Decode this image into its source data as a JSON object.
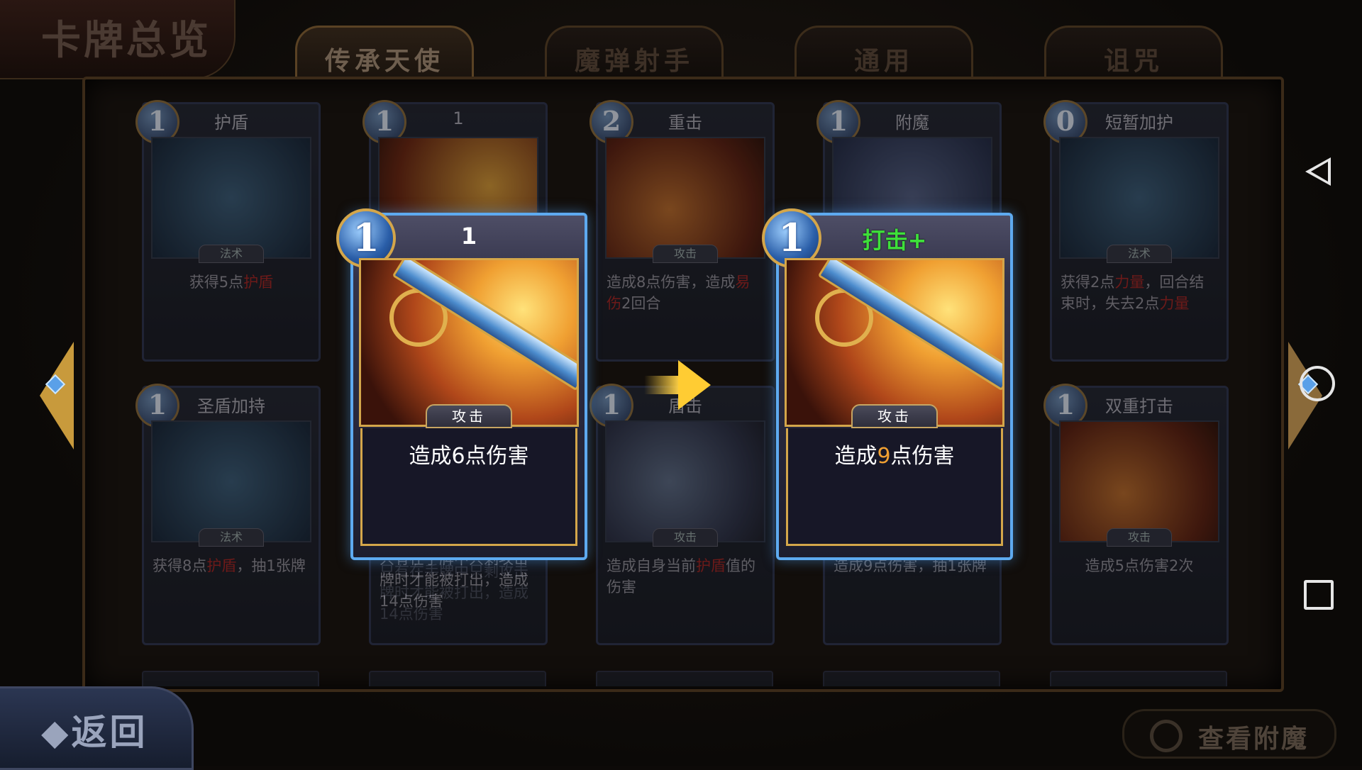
{
  "header": {
    "title": "卡牌总览"
  },
  "tabs": [
    {
      "label": "传承天使",
      "active": true
    },
    {
      "label": "魔弹射手",
      "active": false
    },
    {
      "label": "通用",
      "active": false
    },
    {
      "label": "诅咒",
      "active": false
    }
  ],
  "cards": [
    {
      "cost": "1",
      "name": "护盾",
      "type": "法术",
      "desc_parts": [
        "获得5点",
        "护盾"
      ]
    },
    {
      "cost": "1",
      "name": "1",
      "type": "",
      "desc": "只有在手牌中只剩攻击牌时才能被打出，造成14点伤害"
    },
    {
      "cost": "2",
      "name": "重击",
      "type": "攻击",
      "desc_parts": [
        "造成8点伤害，造成",
        "易伤",
        "2回合"
      ]
    },
    {
      "cost": "1",
      "name": "附魔",
      "type": "",
      "desc": "造成9点伤害，抽1张牌"
    },
    {
      "cost": "0",
      "name": "短暂加护",
      "type": "法术",
      "desc_parts": [
        "获得2点",
        "力量",
        "，回合结束时，失去2点",
        "力量"
      ]
    },
    {
      "cost": "1",
      "name": "圣盾加持",
      "type": "法术",
      "desc_parts": [
        "获得8点",
        "护盾",
        "，抽1张牌"
      ]
    },
    {
      "cost": "1",
      "name": "盾击",
      "type": "攻击",
      "desc_parts": [
        "造成自身当前",
        "护盾",
        "值的伤害"
      ]
    },
    {
      "cost": "1",
      "name": "双重打击",
      "type": "攻击",
      "desc": "造成5点伤害2次"
    }
  ],
  "upgrade": {
    "before": {
      "cost": "1",
      "name": "1",
      "type": "攻击",
      "desc": "造成6点伤害"
    },
    "after": {
      "cost": "1",
      "name": "打击+",
      "type": "攻击",
      "desc_prefix": "造成",
      "desc_value": "9",
      "desc_suffix": "点伤害"
    }
  },
  "colors": {
    "keyword_red": "#a42222",
    "upgrade_green": "#3ee03a",
    "upgrade_value": "#f0a032",
    "highlight_border": "#5eaaf0"
  },
  "icons": {
    "back_nav": "triangle-back-icon",
    "home_nav": "circle-home-icon",
    "recent_nav": "square-recent-icon"
  },
  "bottom": {
    "back_label": "◆返回",
    "enchant_label": "查看附魔"
  }
}
